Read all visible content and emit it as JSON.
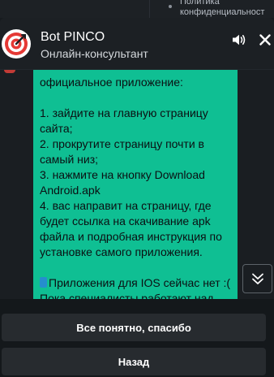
{
  "background": {
    "nav_text": "Политика\nконфиденциальност"
  },
  "header": {
    "title": "Bot PINCO",
    "subtitle": "Онлайн-консультант",
    "avatar_icon": "pinco-target-logo",
    "sound_icon": "speaker-icon",
    "close_icon": "close-icon"
  },
  "message": {
    "intro": "официальное приложение:",
    "steps": [
      "1. зайдите на главную страницу сайта;",
      "2. прокрутите страницу почти в самый низ;",
      "3. нажмите на кнопку Download Android.apk",
      "4. вас направит на страницу, где будет ссылка на скачивание apk файла и подробная инструкция по установке самого приложения."
    ],
    "ios_text": "Приложения для IOS сейчас нет :( Пока специалисты работают над его созданием, вы можете"
  },
  "quick_replies": [
    {
      "label": "Все понятно, спасибо"
    },
    {
      "label": "Назад"
    }
  ],
  "colors": {
    "bubble": "#0fbf93",
    "button": "#272b2f",
    "background": "#1a1e22",
    "brand_red": "#e53935"
  }
}
